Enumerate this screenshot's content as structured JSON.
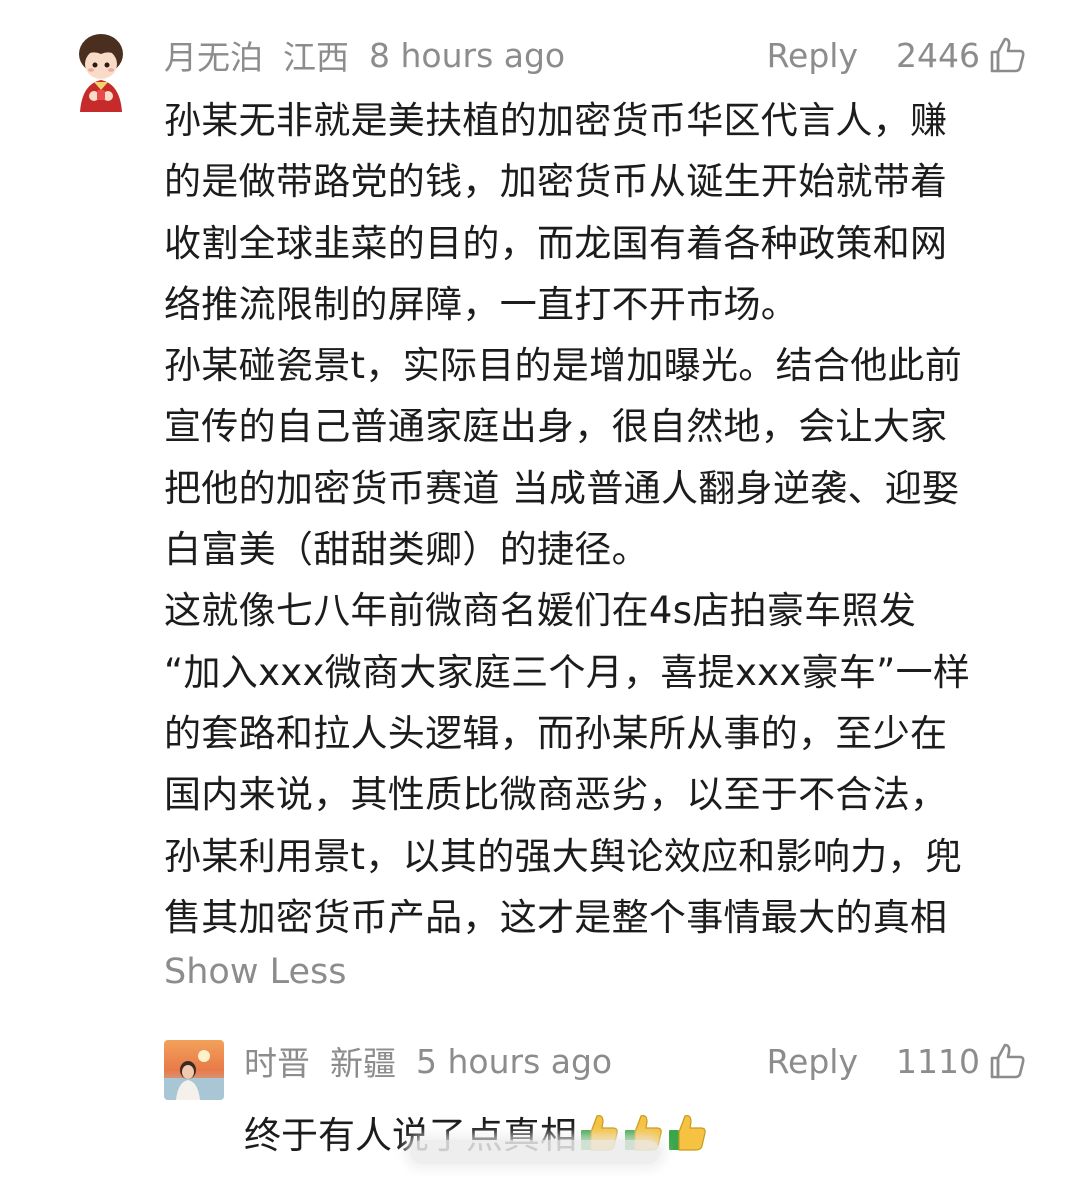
{
  "main_comment": {
    "username": "月无泊",
    "location": "江西",
    "time": "8 hours ago",
    "reply_label": "Reply",
    "like_count": "2446",
    "paragraphs": [
      "孙某无非就是美扶植的加密货币华区代言人，赚",
      "的是做带路党的钱，加密货币从诞生开始就带着",
      "收割全球韭菜的目的，而龙国有着各种政策和网",
      "络推流限制的屏障，一直打不开市场。",
      "孙某碰瓷景t，实际目的是增加曝光。结合他此前",
      "宣传的自己普通家庭出身，很自然地，会让大家",
      "把他的加密货币赛道 当成普通人翻身逆袭、迎娶",
      "白富美（甜甜类卿）的捷径。",
      "这就像七八年前微商名媛们在4s店拍豪车照发",
      "“加入xxx微商大家庭三个月，喜提xxx豪车”一样",
      "的套路和拉人头逻辑，而孙某所从事的，至少在",
      "国内来说，其性质比微商恶劣，以至于不合法，",
      "孙某利用景t，以其的强大舆论效应和影响力，兜",
      "售其加密货币产品，这才是整个事情最大的真相"
    ],
    "show_less_label": "Show Less",
    "avatar_icon": "cartoon-boy-avatar"
  },
  "reply_comment": {
    "username": "时晋",
    "location": "新疆",
    "time": "5 hours ago",
    "reply_label": "Reply",
    "like_count": "1110",
    "text": "终于有人说了点真相",
    "emojis": [
      "thumbs-up-emoji",
      "thumbs-up-emoji",
      "thumbs-up-emoji"
    ],
    "avatar_icon": "sunset-photo-avatar"
  },
  "colors": {
    "meta_gray": "#8c8c8c",
    "body_text": "#1c1c1c",
    "thumb_yellow": "#f5c242",
    "sleeve_green": "#3aa64a"
  }
}
